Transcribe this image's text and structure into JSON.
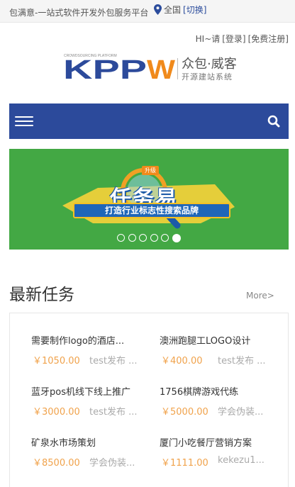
{
  "topbar": {
    "slogan": "包满意-一站式软件开发外包服务平台",
    "location": "全国",
    "switch_label": "[切换]"
  },
  "auth": {
    "greeting": "HI~请",
    "login": "[登录]",
    "register": "[免费注册]"
  },
  "logo": {
    "mark": "KPPW",
    "mark_small": "CROWDSOURCING PLATFORM",
    "name": "众包·威客",
    "tagline": "开源建站系统"
  },
  "navbar": {
    "menu_icon": "hamburger-menu-icon",
    "search_icon": "search-icon",
    "color": "#2c4a9b"
  },
  "banner": {
    "tag": "升级",
    "title": "任务易",
    "subtitle": "打造行业标志性搜索品牌",
    "slide_count": 6,
    "active_slide": 6,
    "color": "#43a844"
  },
  "section": {
    "title": "最新任务",
    "more": "More>"
  },
  "tasks": [
    {
      "name": "需要制作logo的酒店...",
      "price": "￥1050.00",
      "publisher": "test发布 ..."
    },
    {
      "name": "澳洲跑腿工LOGO设计",
      "price": "￥400.00",
      "publisher": "test发布 ..."
    },
    {
      "name": "蓝牙pos机线下线上推广",
      "price": "￥3000.00",
      "publisher": "test发布 ..."
    },
    {
      "name": "1756棋牌游戏代练",
      "price": "￥5000.00",
      "publisher": "学会伪装..."
    },
    {
      "name": "矿泉水市场策划",
      "price": "￥8500.00",
      "publisher": "学会伪装..."
    },
    {
      "name": "厦门小吃餐厅营销方案",
      "price": "￥1111.00",
      "publisher": "kekezu1..."
    }
  ],
  "colors": {
    "accent": "#2c4a9b",
    "price": "#f0a24b",
    "logo_orange": "#f08a1c"
  }
}
